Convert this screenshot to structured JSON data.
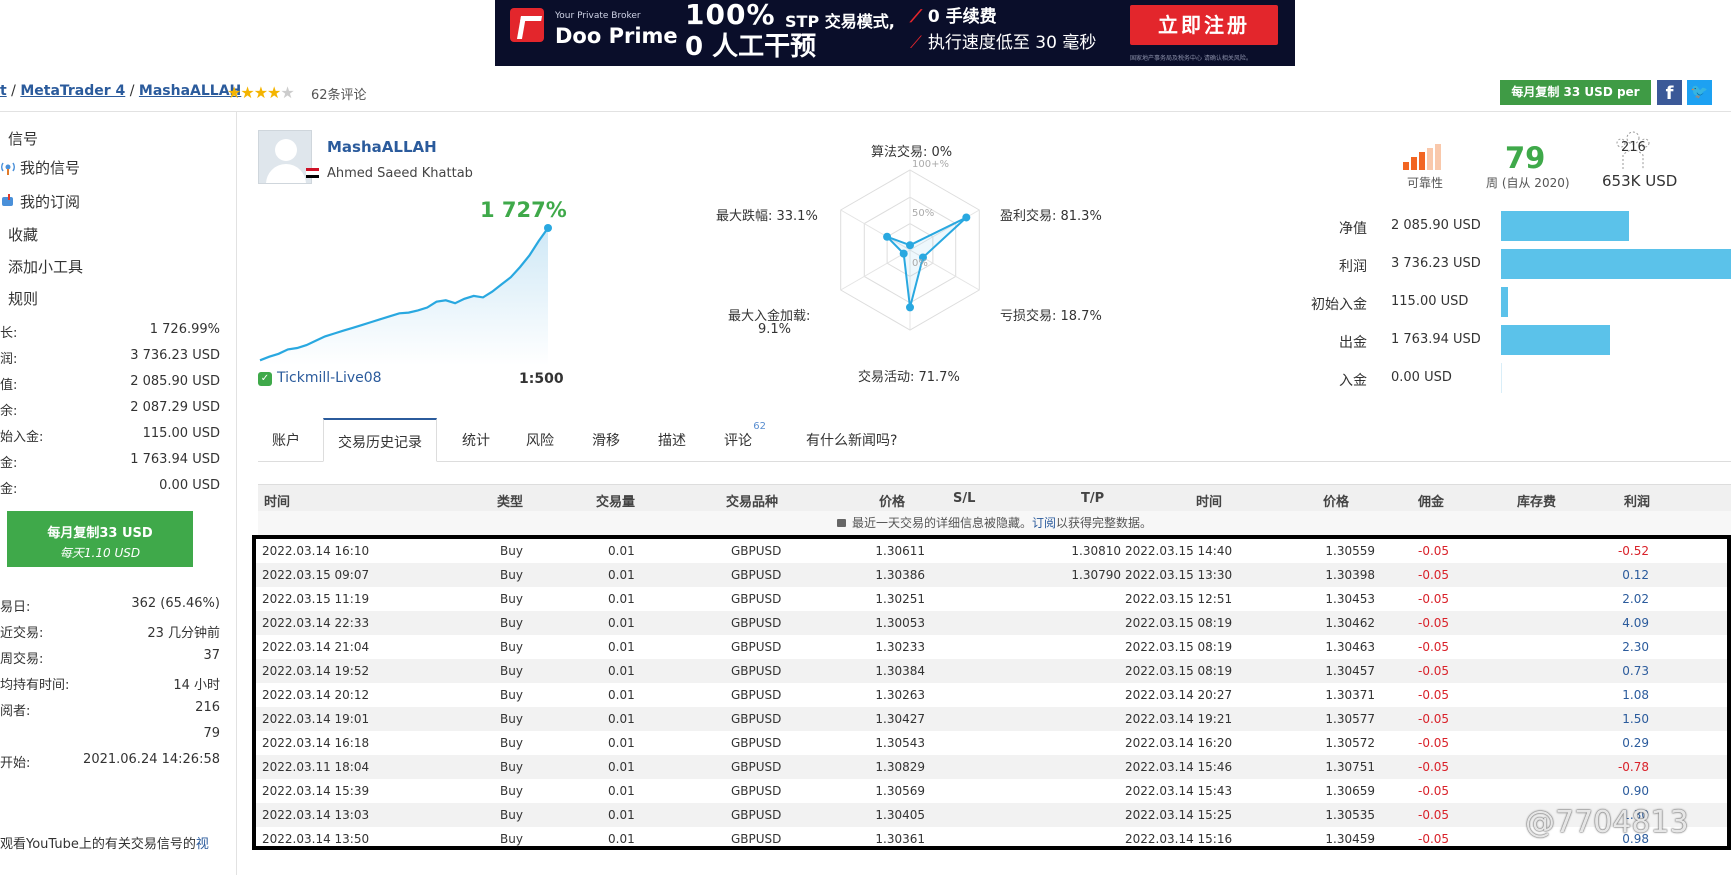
{
  "banner": {
    "broker_tag": "Your Private Broker",
    "brand": "Doo Prime",
    "headline": "100%",
    "headline_sub": "STP 交易模式,",
    "headline2": "0 人工干预",
    "feature1": "0 手续费",
    "feature2": "执行速度低至 30 毫秒",
    "cta": "立即注册",
    "disclaimer": "国家地产事务局及税务中心 请确认相关风险。"
  },
  "breadcrumb": {
    "prefix": "t",
    "sep": " / ",
    "platform": "MetaTrader 4",
    "signal": "MashaALLAH"
  },
  "rating": {
    "stars": "★★★★",
    "off": "★",
    "reviews": "62条评论"
  },
  "top_actions": {
    "copy": "每月复制 33 USD per",
    "facebook": "f",
    "twitter": "🐦"
  },
  "sidebar": {
    "menu": [
      "信号",
      "我的信号",
      "我的订阅",
      "收藏",
      "添加小工具",
      "规则"
    ],
    "stats": [
      {
        "label": "长:",
        "value": "1 726.99%"
      },
      {
        "label": "润:",
        "value": "3 736.23 USD"
      },
      {
        "label": "值:",
        "value": "2 085.90 USD"
      },
      {
        "label": "余:",
        "value": "2 087.29 USD"
      },
      {
        "label": "始入金:",
        "value": "115.00 USD"
      },
      {
        "label": "金:",
        "value": "1 763.94 USD"
      },
      {
        "label": "金:",
        "value": "0.00 USD"
      }
    ],
    "copy_button": {
      "line1": "每月复制33 USD",
      "line2": "每天1.10 USD"
    },
    "stats2": [
      {
        "label": "易日:",
        "value": "362 (65.46%)"
      },
      {
        "label": "近交易:",
        "value": "23 几分钟前"
      },
      {
        "label": "周交易:",
        "value": "37"
      },
      {
        "label": "均持有时间:",
        "value": "14 小时"
      },
      {
        "label": "阅者:",
        "value": "216"
      },
      {
        "label": "",
        "value": "79"
      },
      {
        "label": "开始:",
        "value": "2021.06.24 14:26:58"
      }
    ],
    "youtube_text": "观看YouTube上的有关交易信号的",
    "youtube_link": "视"
  },
  "profile": {
    "name": "MashaALLAH",
    "owner": "Ahmed Saeed Khattab",
    "growth": "1 727%",
    "broker": "Tickmill-Live08",
    "leverage": "1:500"
  },
  "growth_chart": {
    "type": "area",
    "values": [
      0.5,
      3,
      5,
      8,
      9,
      11,
      14,
      17,
      19,
      21,
      23,
      25,
      27,
      29,
      31,
      33,
      33.5,
      35,
      37,
      41,
      42,
      40,
      43,
      45,
      44,
      48,
      53,
      58,
      65,
      73,
      83,
      92
    ],
    "color": "#29a8e0"
  },
  "radar": {
    "labels": {
      "algo": "算法交易: 0%",
      "profit": "盈利交易: 81.3%",
      "loss": "亏损交易: 18.7%",
      "activity": "交易活动: 71.7%",
      "deposit_load_a": "最大入金加载:",
      "deposit_load_b": "9.1%",
      "drawdown": "最大跌幅: 33.1%"
    },
    "scale": {
      "max": "100+%",
      "mid": "50%",
      "zero": "0%"
    },
    "chart_data": {
      "type": "radar",
      "axes": [
        "算法交易",
        "盈利交易",
        "亏损交易",
        "交易活动",
        "最大入金加载",
        "最大跌幅"
      ],
      "values": [
        0,
        81.3,
        18.7,
        71.7,
        9.1,
        33.1
      ]
    }
  },
  "right_stats": {
    "reliability_label": "可靠性",
    "weeks": "79",
    "weeks_label": "周 (自从 2020)",
    "subscribers": "216",
    "subscribers_funds": "653K USD",
    "rows": [
      {
        "label": "净值",
        "value": "2 085.90 USD",
        "fraction": 0.558
      },
      {
        "label": "利润",
        "value": "3 736.23 USD",
        "fraction": 1.0
      },
      {
        "label": "初始入金",
        "value": "115.00 USD",
        "fraction": 0.031
      },
      {
        "label": "出金",
        "value": "1 763.94 USD",
        "fraction": 0.472
      },
      {
        "label": "入金",
        "value": "0.00 USD",
        "fraction": 0
      }
    ]
  },
  "tabs": [
    "账户",
    "交易历史记录",
    "统计",
    "风险",
    "滑移",
    "描述",
    "评论",
    "有什么新闻吗?"
  ],
  "tab_badge": "62",
  "table": {
    "headers": [
      "时间",
      "类型",
      "交易量",
      "交易品种",
      "价格",
      "S/L",
      "T/P",
      "时间",
      "价格",
      "佣金",
      "库存费",
      "利润"
    ],
    "notice_a": "最近一天交易的详细信息被隐藏。",
    "notice_link": "订阅",
    "notice_b": "以获得完整数据。",
    "rows": [
      [
        "2022.03.14 16:10",
        "Buy",
        "0.01",
        "GBPUSD",
        "1.30611",
        "",
        "1.30810",
        "2022.03.15 14:40",
        "1.30559",
        "-0.05",
        "",
        "-0.52"
      ],
      [
        "2022.03.15 09:07",
        "Buy",
        "0.01",
        "GBPUSD",
        "1.30386",
        "",
        "1.30790",
        "2022.03.15 13:30",
        "1.30398",
        "-0.05",
        "",
        "0.12"
      ],
      [
        "2022.03.15 11:19",
        "Buy",
        "0.01",
        "GBPUSD",
        "1.30251",
        "",
        "",
        "2022.03.15 12:51",
        "1.30453",
        "-0.05",
        "",
        "2.02"
      ],
      [
        "2022.03.14 22:33",
        "Buy",
        "0.01",
        "GBPUSD",
        "1.30053",
        "",
        "",
        "2022.03.15 08:19",
        "1.30462",
        "-0.05",
        "",
        "4.09"
      ],
      [
        "2022.03.14 21:04",
        "Buy",
        "0.01",
        "GBPUSD",
        "1.30233",
        "",
        "",
        "2022.03.15 08:19",
        "1.30463",
        "-0.05",
        "",
        "2.30"
      ],
      [
        "2022.03.14 19:52",
        "Buy",
        "0.01",
        "GBPUSD",
        "1.30384",
        "",
        "",
        "2022.03.15 08:19",
        "1.30457",
        "-0.05",
        "",
        "0.73"
      ],
      [
        "2022.03.14 20:12",
        "Buy",
        "0.01",
        "GBPUSD",
        "1.30263",
        "",
        "",
        "2022.03.14 20:27",
        "1.30371",
        "-0.05",
        "",
        "1.08"
      ],
      [
        "2022.03.14 19:01",
        "Buy",
        "0.01",
        "GBPUSD",
        "1.30427",
        "",
        "",
        "2022.03.14 19:21",
        "1.30577",
        "-0.05",
        "",
        "1.50"
      ],
      [
        "2022.03.14 16:18",
        "Buy",
        "0.01",
        "GBPUSD",
        "1.30543",
        "",
        "",
        "2022.03.14 16:20",
        "1.30572",
        "-0.05",
        "",
        "0.29"
      ],
      [
        "2022.03.11 18:04",
        "Buy",
        "0.01",
        "GBPUSD",
        "1.30829",
        "",
        "",
        "2022.03.14 15:46",
        "1.30751",
        "-0.05",
        "",
        "-0.78"
      ],
      [
        "2022.03.14 15:39",
        "Buy",
        "0.01",
        "GBPUSD",
        "1.30569",
        "",
        "",
        "2022.03.14 15:43",
        "1.30659",
        "-0.05",
        "",
        "0.90"
      ],
      [
        "2022.03.14 13:03",
        "Buy",
        "0.01",
        "GBPUSD",
        "1.30405",
        "",
        "",
        "2022.03.14 15:25",
        "1.30535",
        "-0.05",
        "",
        "1.30"
      ],
      [
        "2022.03.14 13:50",
        "Buy",
        "0.01",
        "GBPUSD",
        "1.30361",
        "",
        "",
        "2022.03.14 15:16",
        "1.30459",
        "-0.05",
        "",
        "0.98"
      ]
    ]
  },
  "watermark": "@7704813"
}
